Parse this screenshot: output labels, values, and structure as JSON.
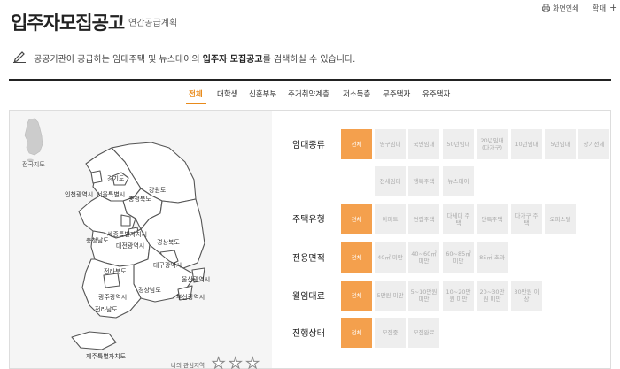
{
  "header": {
    "title": "입주자모집공고",
    "subtitle": "연간공급계획",
    "print_label": "화면인쇄",
    "zoom_label": "확대",
    "zoom_plus": "+"
  },
  "intro": {
    "text_before": "공공기관이 공급하는 임대주택 및 뉴스테이의",
    "text_bold": "입주자 모집공고",
    "text_after": "를 검색하실 수 있습니다."
  },
  "tabs": [
    {
      "label": "전체",
      "active": true
    },
    {
      "label": "대학생",
      "active": false
    },
    {
      "label": "신혼부부",
      "active": false
    },
    {
      "label": "주거취약계층",
      "active": false
    },
    {
      "label": "저소득층",
      "active": false
    },
    {
      "label": "무주택자",
      "active": false
    },
    {
      "label": "유주택자",
      "active": false
    }
  ],
  "map": {
    "nationwide_label": "전국지도",
    "regions": [
      "경기도",
      "서울특별시",
      "인천광역시",
      "강원도",
      "충청북도",
      "세종특별자치시",
      "충청남도",
      "대전광역시",
      "경상북도",
      "전라북도",
      "대구광역시",
      "울산광역시",
      "광주광역시",
      "경상남도",
      "부산광역시",
      "전라남도",
      "제주특별자치도"
    ],
    "favorites_label": "나의 관심지역"
  },
  "filters": {
    "rental_type": {
      "label": "임대종류",
      "options": [
        "전체",
        "영구임대",
        "국민임대",
        "50년임대",
        "20년임대 (다가구)",
        "10년임대",
        "5년임대",
        "장기전세",
        "전세임대",
        "행복주택",
        "뉴스테이"
      ]
    },
    "housing_type": {
      "label": "주택유형",
      "options": [
        "전체",
        "아파트",
        "연립주택",
        "다세대 주택",
        "단독주택",
        "다가구 주택",
        "오피스텔"
      ]
    },
    "area": {
      "label": "전용면적",
      "options": [
        "전체",
        "40㎡ 미만",
        "40~60㎡ 미만",
        "60~85㎡ 미만",
        "85㎡ 초과"
      ]
    },
    "monthly_rent": {
      "label": "월임대료",
      "options": [
        "전체",
        "5만원 미만",
        "5~10만원 미만",
        "10~20만원 미만",
        "20~30만원 미만",
        "30만원 이상"
      ]
    },
    "status": {
      "label": "진행상태",
      "options": [
        "전체",
        "모집중",
        "모집완료"
      ]
    }
  },
  "colors": {
    "accent": "#f4a04d",
    "tab_active": "#e88a1a",
    "button_inactive": "#eeeeee",
    "map_background": "#f5f5f5"
  }
}
